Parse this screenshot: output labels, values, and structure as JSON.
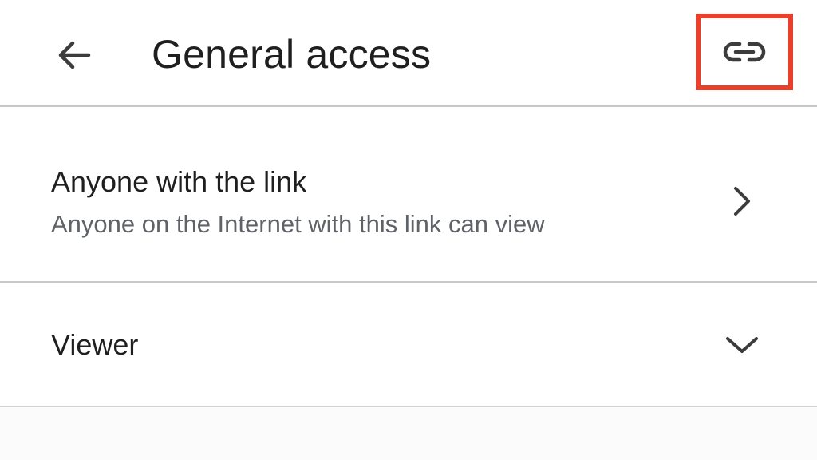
{
  "header": {
    "title": "General access",
    "back_icon": "arrow-back-icon",
    "link_icon": "link-icon",
    "highlight_color": "#e8402a"
  },
  "access": {
    "title": "Anyone with the link",
    "subtitle": "Anyone on the Internet with this link can view",
    "chevron_icon": "chevron-right-icon"
  },
  "role": {
    "selected": "Viewer",
    "chevron_icon": "chevron-down-icon"
  },
  "colors": {
    "text_primary": "#1f1f1f",
    "text_secondary": "#5f6368",
    "divider": "#c8c8c8"
  }
}
